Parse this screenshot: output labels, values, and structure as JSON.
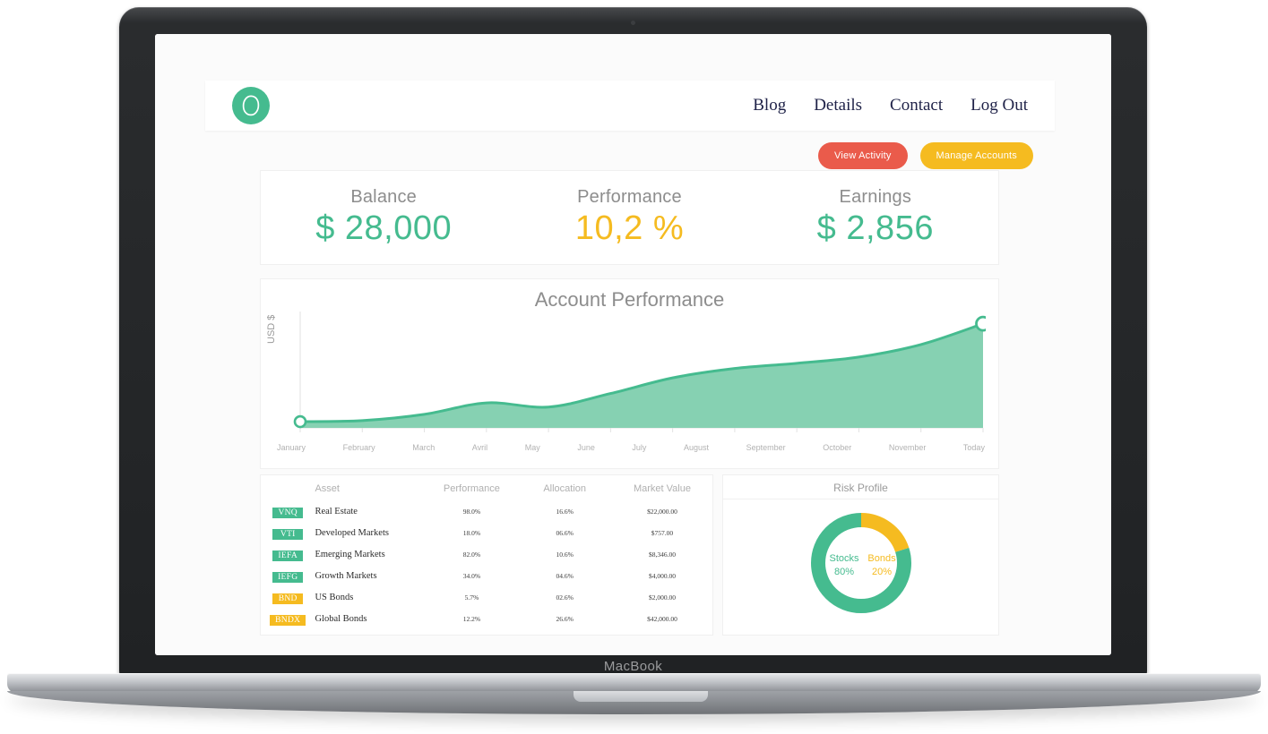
{
  "device": {
    "brand": "MacBook"
  },
  "navbar": {
    "logo_icon": "leaf-logo-icon",
    "links": [
      {
        "label": "Blog"
      },
      {
        "label": "Details"
      },
      {
        "label": "Contact"
      },
      {
        "label": "Log Out"
      }
    ]
  },
  "actions": {
    "view_activity": "View Activity",
    "manage_accounts": "Manage Accounts",
    "view_activity_color": "#ea5b4b",
    "manage_accounts_color": "#f5bb20"
  },
  "stats": [
    {
      "label": "Balance",
      "value": "$ 28,000",
      "color": "#45bb8f"
    },
    {
      "label": "Performance",
      "value": "10,2 %",
      "color": "#f5bb20"
    },
    {
      "label": "Earnings",
      "value": "$ 2,856",
      "color": "#45bb8f"
    }
  ],
  "chart_data": {
    "type": "area",
    "title": "Account Performance",
    "xlabel": "",
    "ylabel": "USD $",
    "categories": [
      "January",
      "February",
      "March",
      "Avril",
      "May",
      "June",
      "July",
      "August",
      "September",
      "October",
      "November",
      "Today"
    ],
    "values": [
      6,
      7,
      13,
      24,
      20,
      33,
      48,
      57,
      62,
      68,
      80,
      100
    ],
    "ylim": [
      0,
      110
    ],
    "grid": false,
    "legend": "none",
    "line_color": "#45bb8f",
    "fill_color": "#7fcfae",
    "endpoint_markers": [
      "January",
      "Today"
    ]
  },
  "holdings": {
    "columns": [
      "",
      "Asset",
      "Performance",
      "Allocation",
      "Market Value"
    ],
    "rows": [
      {
        "ticker": "VNQ",
        "ticker_color": "green",
        "asset": "Real Estate",
        "performance": "98.0%",
        "allocation": "16.6%",
        "market_value": "$22,000.00"
      },
      {
        "ticker": "VTI",
        "ticker_color": "green",
        "asset": "Developed Markets",
        "performance": "18.0%",
        "allocation": "06.6%",
        "market_value": "$757.00"
      },
      {
        "ticker": "IEFA",
        "ticker_color": "green",
        "asset": "Emerging Markets",
        "performance": "82.0%",
        "allocation": "10.6%",
        "market_value": "$8,346.00"
      },
      {
        "ticker": "IEFG",
        "ticker_color": "green",
        "asset": "Growth Markets",
        "performance": "34.0%",
        "allocation": "04.6%",
        "market_value": "$4,000.00"
      },
      {
        "ticker": "BND",
        "ticker_color": "yellow",
        "asset": "US Bonds",
        "performance": "5.7%",
        "allocation": "02.6%",
        "market_value": "$2,000.00"
      },
      {
        "ticker": "BNDX",
        "ticker_color": "yellow",
        "asset": "Global Bonds",
        "performance": "12.2%",
        "allocation": "26.6%",
        "market_value": "$42,000.00"
      }
    ]
  },
  "risk_profile": {
    "title": "Risk Profile",
    "chart_data": {
      "type": "pie",
      "title": "Risk Profile",
      "categories": [
        "Stocks",
        "Bonds"
      ],
      "values": [
        80,
        20
      ],
      "colors": [
        "#45bb8f",
        "#f5bb20"
      ],
      "labels": [
        "80%",
        "20%"
      ]
    },
    "stocks_label": "Stocks",
    "stocks_pct": "80%",
    "bonds_label": "Bonds",
    "bonds_pct": "20%"
  }
}
